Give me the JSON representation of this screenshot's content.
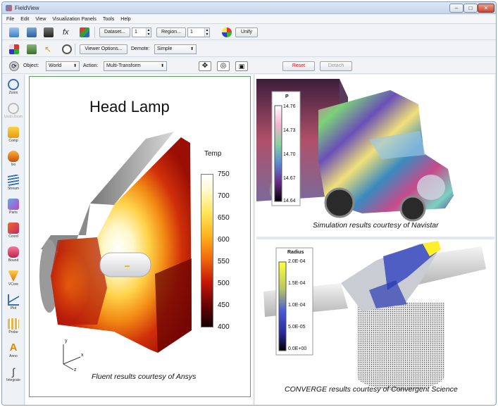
{
  "window": {
    "title": "FieldView",
    "min_glyph": "–",
    "max_glyph": "□",
    "close_glyph": "✕"
  },
  "menubar": [
    "File",
    "Edit",
    "View",
    "Visualization Panels",
    "Tools",
    "Help"
  ],
  "toolbar1": {
    "dataset_label": "Dataset...",
    "dataset_value": "1",
    "region_label": "Region...",
    "region_value": "1",
    "unify_label": "Unify"
  },
  "toolbar2": {
    "viewer_options_label": "Viewer Options...",
    "demote_label": "Demote:",
    "demote_value": "Simple"
  },
  "toolbar3": {
    "object_label": "Object:",
    "object_value": "World",
    "action_label": "Action:",
    "action_value": "Multi-Transform",
    "reset_label": "Reset",
    "detach_label": "Detach"
  },
  "sidebar": [
    "Zoom",
    "Undo Zoom",
    "Comp",
    "Iso",
    "Stream",
    "Parts",
    "Coord",
    "Bound",
    "VCore",
    "Plot",
    "Probe",
    "Anno",
    "Integrate"
  ],
  "panels": {
    "headlamp": {
      "title": "Head Lamp",
      "legend_title": "Temp",
      "legend_ticks": [
        "750",
        "700",
        "650",
        "600",
        "550",
        "500",
        "450",
        "400"
      ],
      "axis_x": "x",
      "axis_y": "y",
      "axis_z": "z",
      "credit": "Fluent results courtesy of Ansys"
    },
    "truck": {
      "legend_title": "P",
      "legend_ticks": [
        "14.76",
        "14.73",
        "14.70",
        "14.67",
        "14.64"
      ],
      "credit": "Simulation results courtesy of Navistar"
    },
    "engine": {
      "legend_title": "Radius",
      "legend_ticks": [
        "2.0E-04",
        "1.5E-04",
        "1.0E-04",
        "5.0E-05",
        "0.0E+00"
      ],
      "credit": "CONVERGE results courtesy of Convergent Science"
    }
  },
  "colors": {
    "active_pane_border": "#4fa85a",
    "reset_text": "#d21414"
  }
}
